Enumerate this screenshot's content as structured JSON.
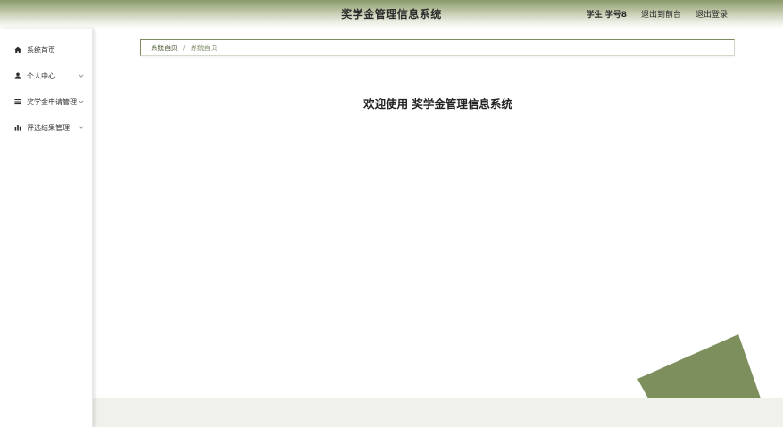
{
  "header": {
    "title": "奖学金管理信息系统",
    "user_label": "学生 学号8",
    "to_front_label": "退出到前台",
    "logout_label": "退出登录"
  },
  "sidebar": {
    "items": [
      {
        "label": "系统首页",
        "icon": "home-icon",
        "has_submenu": false
      },
      {
        "label": "个人中心",
        "icon": "user-icon",
        "has_submenu": true
      },
      {
        "label": "奖学金申请管理",
        "icon": "list-icon",
        "has_submenu": true
      },
      {
        "label": "评选结果管理",
        "icon": "bar-chart-icon",
        "has_submenu": true
      }
    ]
  },
  "breadcrumb": {
    "home": "系统首页",
    "separator": "/",
    "current": "系统首页"
  },
  "main": {
    "welcome": "欢迎使用 奖学金管理信息系统"
  },
  "colors": {
    "accent": "#7d8c60",
    "header_dark": "#8a9a6a",
    "decor": "#7e8f5e"
  }
}
